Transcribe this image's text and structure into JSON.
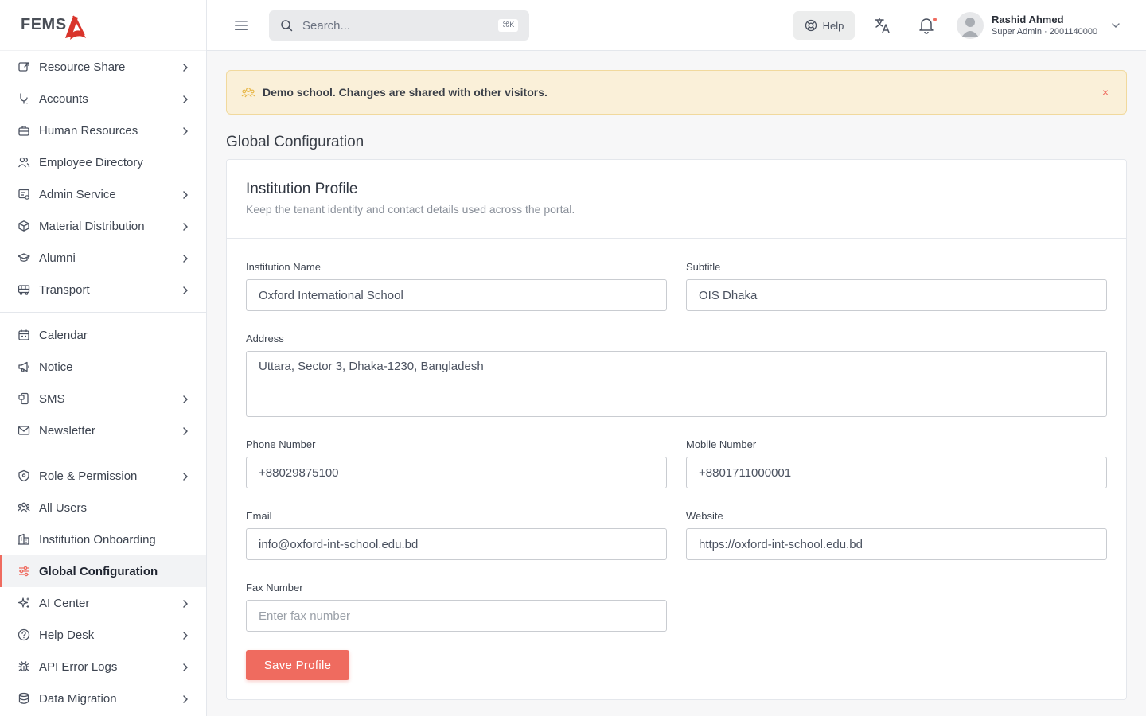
{
  "app": {
    "logo_text": "FEMS"
  },
  "sidebar": {
    "groups": [
      [
        {
          "label": "Resource Share",
          "icon": "share-icon",
          "chevron": true
        },
        {
          "label": "Accounts",
          "icon": "branch-icon",
          "chevron": true
        },
        {
          "label": "Human Resources",
          "icon": "briefcase-icon",
          "chevron": true
        },
        {
          "label": "Employee Directory",
          "icon": "users-icon",
          "chevron": false
        },
        {
          "label": "Admin Service",
          "icon": "admin-service-icon",
          "chevron": true
        },
        {
          "label": "Material Distribution",
          "icon": "box-icon",
          "chevron": true
        },
        {
          "label": "Alumni",
          "icon": "graduation-cap-icon",
          "chevron": true
        },
        {
          "label": "Transport",
          "icon": "bus-icon",
          "chevron": true
        }
      ],
      [
        {
          "label": "Calendar",
          "icon": "calendar-icon",
          "chevron": false
        },
        {
          "label": "Notice",
          "icon": "megaphone-icon",
          "chevron": false
        },
        {
          "label": "SMS",
          "icon": "sms-icon",
          "chevron": true
        },
        {
          "label": "Newsletter",
          "icon": "mail-icon",
          "chevron": true
        }
      ],
      [
        {
          "label": "Role & Permission",
          "icon": "shield-icon",
          "chevron": true
        },
        {
          "label": "All Users",
          "icon": "user-group-icon",
          "chevron": false
        },
        {
          "label": "Institution Onboarding",
          "icon": "building-icon",
          "chevron": false
        },
        {
          "label": "Global Configuration",
          "icon": "sliders-icon",
          "chevron": false,
          "active": true
        },
        {
          "label": "AI Center",
          "icon": "sparkles-icon",
          "chevron": true
        },
        {
          "label": "Help Desk",
          "icon": "help-circle-icon",
          "chevron": true
        },
        {
          "label": "API Error Logs",
          "icon": "bug-icon",
          "chevron": true
        },
        {
          "label": "Data Migration",
          "icon": "database-icon",
          "chevron": true
        }
      ]
    ]
  },
  "topbar": {
    "search_placeholder": "Search...",
    "search_shortcut": "⌘K",
    "help_label": "Help",
    "user_name": "Rashid Ahmed",
    "user_role": "Super Admin · 2001140000"
  },
  "banner": {
    "text": "Demo school. Changes are shared with other visitors.",
    "close": "×"
  },
  "page": {
    "title": "Global Configuration"
  },
  "card": {
    "title": "Institution Profile",
    "subtitle": "Keep the tenant identity and contact details used across the portal."
  },
  "form": {
    "institution_name": {
      "label": "Institution Name",
      "value": "Oxford International School"
    },
    "subtitle": {
      "label": "Subtitle",
      "value": "OIS Dhaka"
    },
    "address": {
      "label": "Address",
      "value": "Uttara, Sector 3, Dhaka-1230, Bangladesh"
    },
    "phone": {
      "label": "Phone Number",
      "value": "+88029875100"
    },
    "mobile": {
      "label": "Mobile Number",
      "value": "+8801711000001"
    },
    "email": {
      "label": "Email",
      "value": "info@oxford-int-school.edu.bd"
    },
    "website": {
      "label": "Website",
      "value": "https://oxford-int-school.edu.bd"
    },
    "fax": {
      "label": "Fax Number",
      "placeholder": "Enter fax number"
    },
    "save_label": "Save Profile"
  },
  "colors": {
    "accent": "#ef6b5f",
    "banner_bg": "#faf0d9",
    "banner_border": "#f1d99d"
  }
}
